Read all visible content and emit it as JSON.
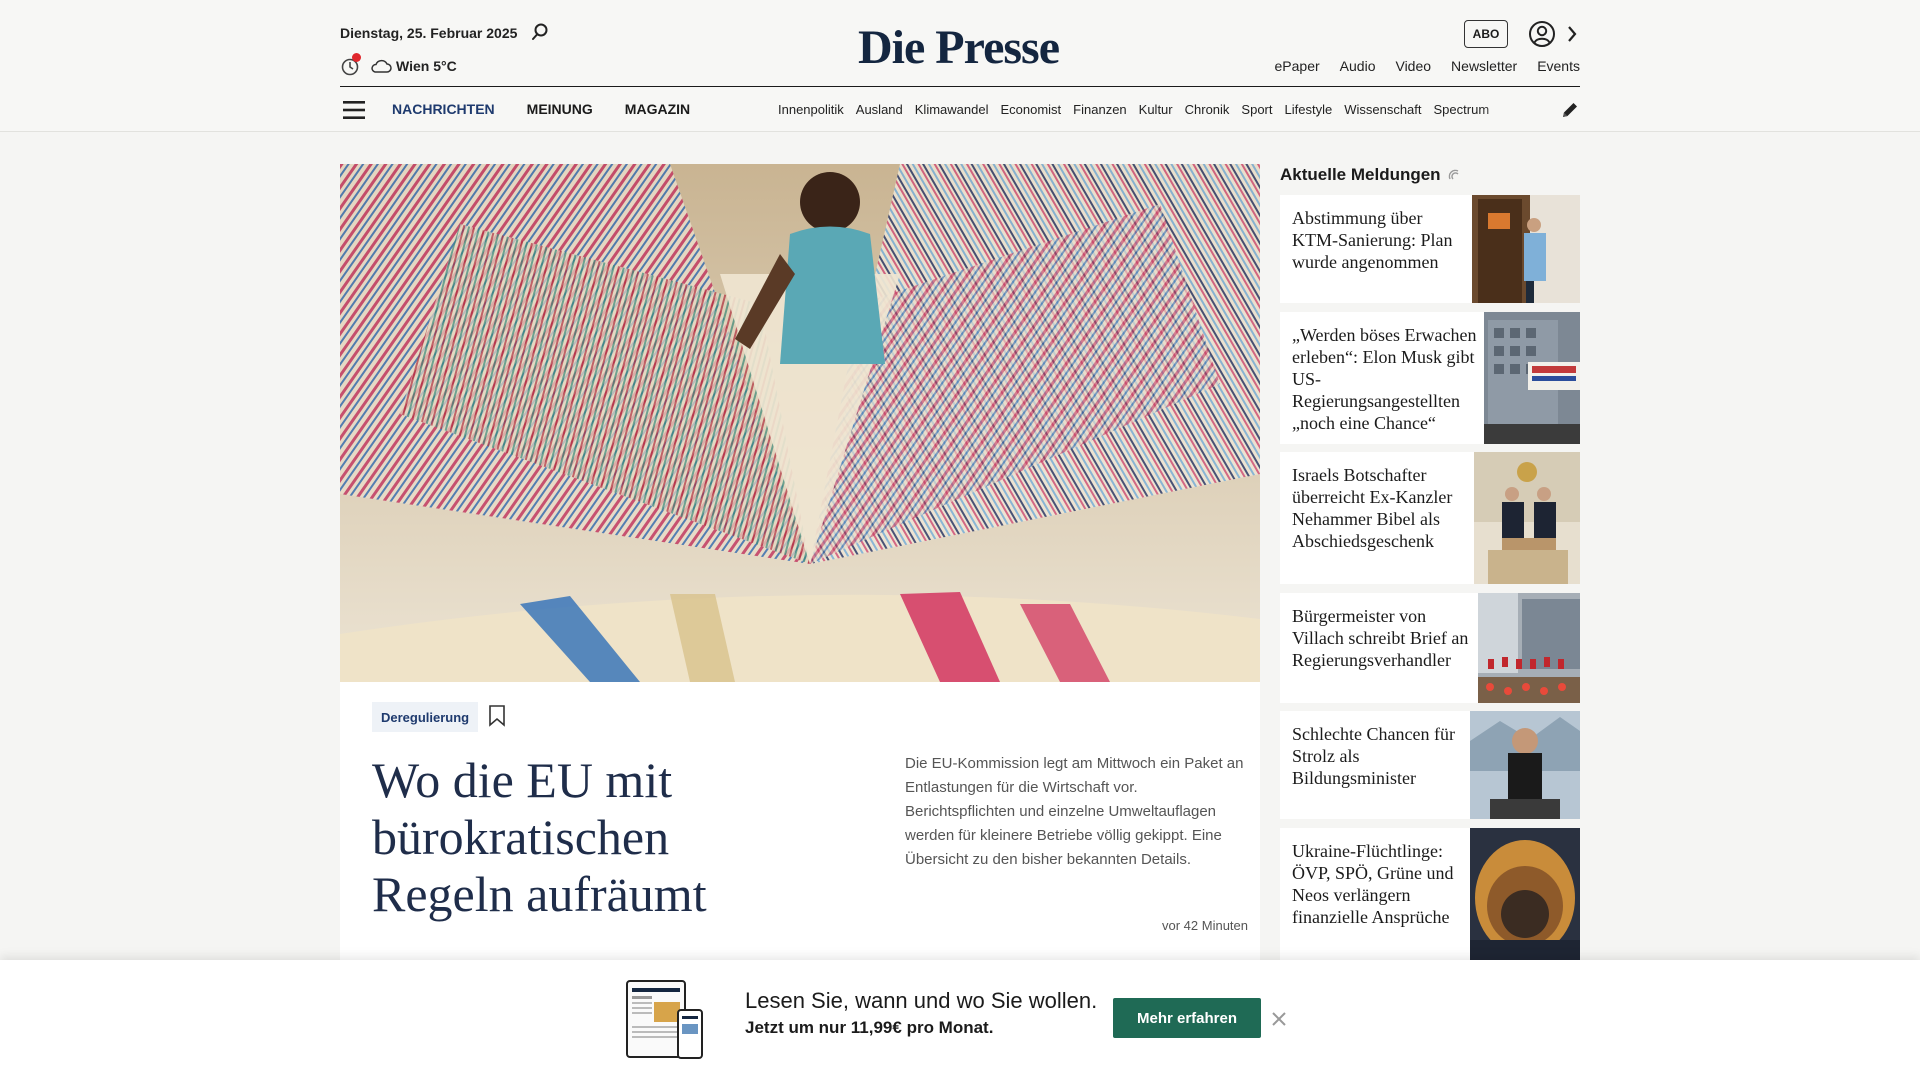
{
  "header": {
    "date": "Dienstag, 25. Februar 2025",
    "weather": "Wien 5°C",
    "logo": "Die Presse",
    "abo_label": "ABO",
    "top_links": [
      "ePaper",
      "Audio",
      "Video",
      "Newsletter",
      "Events"
    ],
    "main_nav": [
      "NACHRICHTEN",
      "MEINUNG",
      "MAGAZIN"
    ],
    "sub_nav": [
      "Innenpolitik",
      "Ausland",
      "Klimawandel",
      "Economist",
      "Finanzen",
      "Kultur",
      "Chronik",
      "Sport",
      "Lifestyle",
      "Wissenschaft",
      "Spectrum"
    ]
  },
  "hero": {
    "tag": "Deregulierung",
    "headline": "Wo die EU mit bürokratischen Regeln aufräumt",
    "teaser": "Die EU-Kommission legt am Mittwoch ein Paket an Entlastungen für die Wirtschaft vor. Berichtspflichten und einzelne Umweltauflagen werden für kleinere Betriebe völlig gekippt. Eine Übersicht zu den bisher bekannten Details.",
    "time": "vor 42 Minuten"
  },
  "sidebar": {
    "title": "Aktuelle Meldungen",
    "items": [
      {
        "text": "Abstimmung über KTM-Sanierung: Plan wurde angenommen"
      },
      {
        "text": "„Werden böses Erwachen erleben“: Elon Musk gibt US-Regierungsangestellten „noch eine Chance“"
      },
      {
        "text": "Israels Botschafter überreicht Ex-Kanzler Nehammer Bibel als Abschiedsgeschenk"
      },
      {
        "text": "Bürgermeister von Villach schreibt Brief an Regierungsverhandler"
      },
      {
        "text": "Schlechte Chancen für Strolz als Bildungsminister"
      },
      {
        "text": "Ukraine-Flüchtlinge: ÖVP, SPÖ, Grüne und Neos verlängern finanzielle Ansprüche"
      }
    ]
  },
  "banner": {
    "headline": "Lesen Sie, wann und wo Sie wollen.",
    "subline": "Jetzt um nur 11,99€ pro Monat.",
    "button": "Mehr erfahren"
  },
  "colors": {
    "brand_navy": "#142640",
    "nav_active": "#1e3a6e",
    "cta_green": "#1f6a55",
    "notification_red": "#e0262c"
  }
}
